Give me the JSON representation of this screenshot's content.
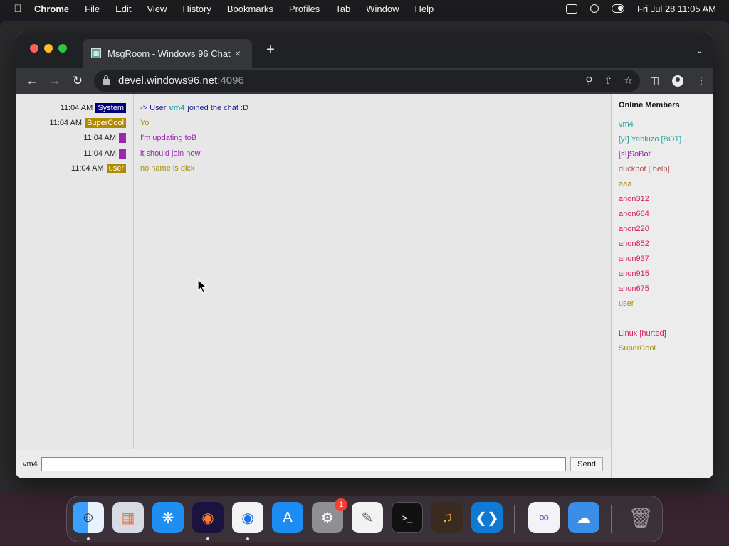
{
  "menubar": {
    "app_name": "Chrome",
    "items": [
      "File",
      "Edit",
      "View",
      "History",
      "Bookmarks",
      "Profiles",
      "Tab",
      "Window",
      "Help"
    ],
    "datetime": "Fri Jul 28  11:05 AM"
  },
  "browser": {
    "tab_title": "MsgRoom - Windows 96 Chat",
    "tab_close": "×",
    "new_tab": "+",
    "url_host": "devel.windows96.net",
    "url_port": ":4096"
  },
  "chat": {
    "messages": [
      {
        "time": "11:04 AM",
        "user": "System",
        "color": "#00007a",
        "parts": [
          "-> User",
          "vm4",
          "joined the chat :D"
        ],
        "text_color": "#1a1a90"
      },
      {
        "time": "11:04 AM",
        "user": "SuperCool",
        "color": "#b08a00",
        "text": "Yo",
        "text_color": "#a8900a"
      },
      {
        "time": "11:04 AM",
        "user": "",
        "color": "#9c27b0",
        "text": "I'm updating toB",
        "text_color": "#9c27b0"
      },
      {
        "time": "11:04 AM",
        "user": "",
        "color": "#9c27b0",
        "text": "it should join now",
        "text_color": "#9c27b0"
      },
      {
        "time": "11:04 AM",
        "user": "user",
        "color": "#b08a00",
        "text": "no name is dick",
        "text_color": "#a8900a"
      }
    ]
  },
  "sidebar": {
    "title": "Online Members",
    "members": [
      {
        "name": "vm4",
        "color": "#27a4a4"
      },
      {
        "name": "[y!] Yabluzo [BOT]",
        "color": "#27a4a4"
      },
      {
        "name": "[s!]SoBot",
        "color": "#9c27b0"
      },
      {
        "name": "duckbot [.help]",
        "color": "#b05050"
      },
      {
        "name": "aaa",
        "color": "#a8900a"
      },
      {
        "name": "anon312",
        "color": "#d81b60"
      },
      {
        "name": "anon664",
        "color": "#d81b60"
      },
      {
        "name": "anon220",
        "color": "#d81b60"
      },
      {
        "name": "anon852",
        "color": "#d81b60"
      },
      {
        "name": "anon937",
        "color": "#d81b60"
      },
      {
        "name": "anon915",
        "color": "#d81b60"
      },
      {
        "name": "anon675",
        "color": "#d81b60"
      },
      {
        "name": "user",
        "color": "#a8900a"
      },
      {
        "name": "",
        "color": "#000000"
      },
      {
        "name": "Linux [hurted]",
        "color": "#d81b60"
      },
      {
        "name": "SuperCool",
        "color": "#a8900a"
      }
    ]
  },
  "input": {
    "nickname": "vm4",
    "value": "",
    "send_label": "Send"
  },
  "dock": {
    "notification_count": "1"
  }
}
